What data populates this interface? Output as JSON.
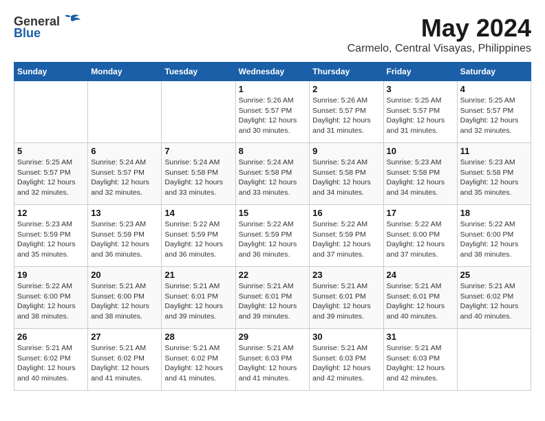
{
  "header": {
    "logo_general": "General",
    "logo_blue": "Blue",
    "month": "May 2024",
    "location": "Carmelo, Central Visayas, Philippines"
  },
  "columns": [
    "Sunday",
    "Monday",
    "Tuesday",
    "Wednesday",
    "Thursday",
    "Friday",
    "Saturday"
  ],
  "weeks": [
    [
      {
        "day": "",
        "sunrise": "",
        "sunset": "",
        "daylight": ""
      },
      {
        "day": "",
        "sunrise": "",
        "sunset": "",
        "daylight": ""
      },
      {
        "day": "",
        "sunrise": "",
        "sunset": "",
        "daylight": ""
      },
      {
        "day": "1",
        "sunrise": "Sunrise: 5:26 AM",
        "sunset": "Sunset: 5:57 PM",
        "daylight": "Daylight: 12 hours and 30 minutes."
      },
      {
        "day": "2",
        "sunrise": "Sunrise: 5:26 AM",
        "sunset": "Sunset: 5:57 PM",
        "daylight": "Daylight: 12 hours and 31 minutes."
      },
      {
        "day": "3",
        "sunrise": "Sunrise: 5:25 AM",
        "sunset": "Sunset: 5:57 PM",
        "daylight": "Daylight: 12 hours and 31 minutes."
      },
      {
        "day": "4",
        "sunrise": "Sunrise: 5:25 AM",
        "sunset": "Sunset: 5:57 PM",
        "daylight": "Daylight: 12 hours and 32 minutes."
      }
    ],
    [
      {
        "day": "5",
        "sunrise": "Sunrise: 5:25 AM",
        "sunset": "Sunset: 5:57 PM",
        "daylight": "Daylight: 12 hours and 32 minutes."
      },
      {
        "day": "6",
        "sunrise": "Sunrise: 5:24 AM",
        "sunset": "Sunset: 5:57 PM",
        "daylight": "Daylight: 12 hours and 32 minutes."
      },
      {
        "day": "7",
        "sunrise": "Sunrise: 5:24 AM",
        "sunset": "Sunset: 5:58 PM",
        "daylight": "Daylight: 12 hours and 33 minutes."
      },
      {
        "day": "8",
        "sunrise": "Sunrise: 5:24 AM",
        "sunset": "Sunset: 5:58 PM",
        "daylight": "Daylight: 12 hours and 33 minutes."
      },
      {
        "day": "9",
        "sunrise": "Sunrise: 5:24 AM",
        "sunset": "Sunset: 5:58 PM",
        "daylight": "Daylight: 12 hours and 34 minutes."
      },
      {
        "day": "10",
        "sunrise": "Sunrise: 5:23 AM",
        "sunset": "Sunset: 5:58 PM",
        "daylight": "Daylight: 12 hours and 34 minutes."
      },
      {
        "day": "11",
        "sunrise": "Sunrise: 5:23 AM",
        "sunset": "Sunset: 5:58 PM",
        "daylight": "Daylight: 12 hours and 35 minutes."
      }
    ],
    [
      {
        "day": "12",
        "sunrise": "Sunrise: 5:23 AM",
        "sunset": "Sunset: 5:59 PM",
        "daylight": "Daylight: 12 hours and 35 minutes."
      },
      {
        "day": "13",
        "sunrise": "Sunrise: 5:23 AM",
        "sunset": "Sunset: 5:59 PM",
        "daylight": "Daylight: 12 hours and 36 minutes."
      },
      {
        "day": "14",
        "sunrise": "Sunrise: 5:22 AM",
        "sunset": "Sunset: 5:59 PM",
        "daylight": "Daylight: 12 hours and 36 minutes."
      },
      {
        "day": "15",
        "sunrise": "Sunrise: 5:22 AM",
        "sunset": "Sunset: 5:59 PM",
        "daylight": "Daylight: 12 hours and 36 minutes."
      },
      {
        "day": "16",
        "sunrise": "Sunrise: 5:22 AM",
        "sunset": "Sunset: 5:59 PM",
        "daylight": "Daylight: 12 hours and 37 minutes."
      },
      {
        "day": "17",
        "sunrise": "Sunrise: 5:22 AM",
        "sunset": "Sunset: 6:00 PM",
        "daylight": "Daylight: 12 hours and 37 minutes."
      },
      {
        "day": "18",
        "sunrise": "Sunrise: 5:22 AM",
        "sunset": "Sunset: 6:00 PM",
        "daylight": "Daylight: 12 hours and 38 minutes."
      }
    ],
    [
      {
        "day": "19",
        "sunrise": "Sunrise: 5:22 AM",
        "sunset": "Sunset: 6:00 PM",
        "daylight": "Daylight: 12 hours and 38 minutes."
      },
      {
        "day": "20",
        "sunrise": "Sunrise: 5:21 AM",
        "sunset": "Sunset: 6:00 PM",
        "daylight": "Daylight: 12 hours and 38 minutes."
      },
      {
        "day": "21",
        "sunrise": "Sunrise: 5:21 AM",
        "sunset": "Sunset: 6:01 PM",
        "daylight": "Daylight: 12 hours and 39 minutes."
      },
      {
        "day": "22",
        "sunrise": "Sunrise: 5:21 AM",
        "sunset": "Sunset: 6:01 PM",
        "daylight": "Daylight: 12 hours and 39 minutes."
      },
      {
        "day": "23",
        "sunrise": "Sunrise: 5:21 AM",
        "sunset": "Sunset: 6:01 PM",
        "daylight": "Daylight: 12 hours and 39 minutes."
      },
      {
        "day": "24",
        "sunrise": "Sunrise: 5:21 AM",
        "sunset": "Sunset: 6:01 PM",
        "daylight": "Daylight: 12 hours and 40 minutes."
      },
      {
        "day": "25",
        "sunrise": "Sunrise: 5:21 AM",
        "sunset": "Sunset: 6:02 PM",
        "daylight": "Daylight: 12 hours and 40 minutes."
      }
    ],
    [
      {
        "day": "26",
        "sunrise": "Sunrise: 5:21 AM",
        "sunset": "Sunset: 6:02 PM",
        "daylight": "Daylight: 12 hours and 40 minutes."
      },
      {
        "day": "27",
        "sunrise": "Sunrise: 5:21 AM",
        "sunset": "Sunset: 6:02 PM",
        "daylight": "Daylight: 12 hours and 41 minutes."
      },
      {
        "day": "28",
        "sunrise": "Sunrise: 5:21 AM",
        "sunset": "Sunset: 6:02 PM",
        "daylight": "Daylight: 12 hours and 41 minutes."
      },
      {
        "day": "29",
        "sunrise": "Sunrise: 5:21 AM",
        "sunset": "Sunset: 6:03 PM",
        "daylight": "Daylight: 12 hours and 41 minutes."
      },
      {
        "day": "30",
        "sunrise": "Sunrise: 5:21 AM",
        "sunset": "Sunset: 6:03 PM",
        "daylight": "Daylight: 12 hours and 42 minutes."
      },
      {
        "day": "31",
        "sunrise": "Sunrise: 5:21 AM",
        "sunset": "Sunset: 6:03 PM",
        "daylight": "Daylight: 12 hours and 42 minutes."
      },
      {
        "day": "",
        "sunrise": "",
        "sunset": "",
        "daylight": ""
      }
    ]
  ]
}
